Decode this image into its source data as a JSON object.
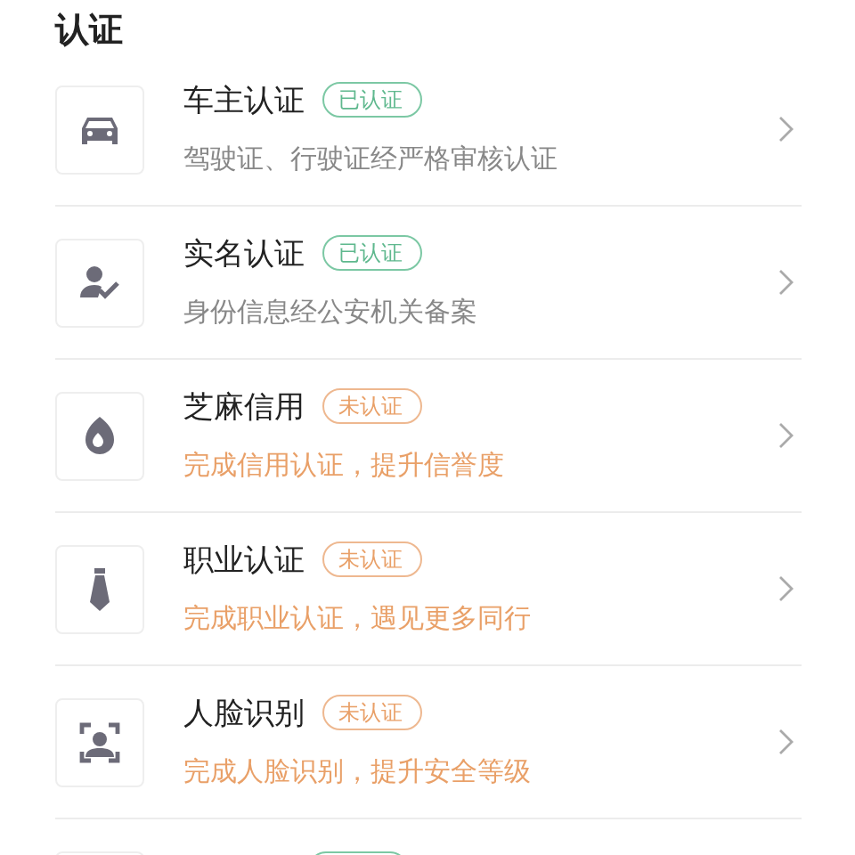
{
  "title": "认证",
  "items": [
    {
      "title": "车主认证",
      "badge": "已认证",
      "verified": true,
      "subtitle": "驾驶证、行驶证经严格审核认证"
    },
    {
      "title": "实名认证",
      "badge": "已认证",
      "verified": true,
      "subtitle": "身份信息经公安机关备案"
    },
    {
      "title": "芝麻信用",
      "badge": "未认证",
      "verified": false,
      "subtitle": "完成信用认证，提升信誉度"
    },
    {
      "title": "职业认证",
      "badge": "未认证",
      "verified": false,
      "subtitle": "完成职业认证，遇见更多同行"
    },
    {
      "title": "人脸识别",
      "badge": "未认证",
      "verified": false,
      "subtitle": "完成人脸识别，提升安全等级"
    },
    {
      "verified": true
    }
  ]
}
